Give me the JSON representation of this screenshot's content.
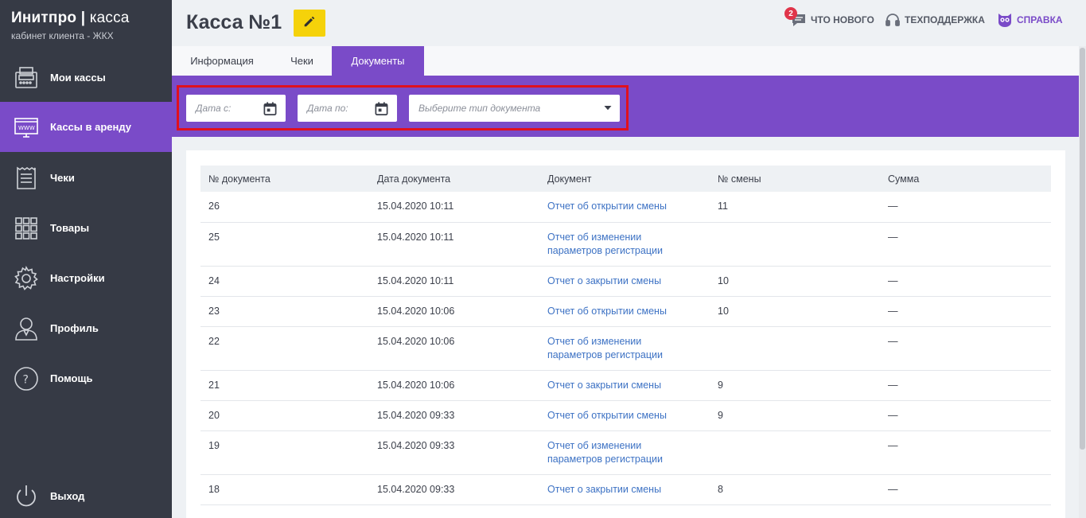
{
  "brand": {
    "title_bold": "Инитпро",
    "title_sep": " | ",
    "title_thin": "касса",
    "subtitle": "кабинет клиента - ЖКХ"
  },
  "sidebar": {
    "items": [
      {
        "label": "Мои кассы",
        "icon": "cash-register-icon",
        "active": false
      },
      {
        "label": "Кассы в аренду",
        "icon": "monitor-www-icon",
        "active": true
      },
      {
        "label": "Чеки",
        "icon": "receipt-icon",
        "active": false
      },
      {
        "label": "Товары",
        "icon": "grid-icon",
        "active": false
      },
      {
        "label": "Настройки",
        "icon": "gear-icon",
        "active": false
      },
      {
        "label": "Профиль",
        "icon": "user-icon",
        "active": false
      },
      {
        "label": "Помощь",
        "icon": "question-icon",
        "active": false
      }
    ],
    "logout": {
      "label": "Выход",
      "icon": "power-icon"
    }
  },
  "header": {
    "title": "Касса №1",
    "whats_new": {
      "label": "ЧТО НОВОГО",
      "badge": "2"
    },
    "support": {
      "label": "ТЕХПОДДЕРЖКА"
    },
    "help": {
      "label": "СПРАВКА"
    }
  },
  "tabs": [
    {
      "label": "Информация",
      "active": false
    },
    {
      "label": "Чеки",
      "active": false
    },
    {
      "label": "Документы",
      "active": true
    }
  ],
  "filters": {
    "date_from_placeholder": "Дата с:",
    "date_to_placeholder": "Дата по:",
    "doc_type_placeholder": "Выберите тип документа"
  },
  "table": {
    "columns": [
      "№ документа",
      "Дата документа",
      "Документ",
      "№ смены",
      "Сумма"
    ],
    "rows": [
      {
        "num": "26",
        "date": "15.04.2020 10:11",
        "doc1": "Отчет об открытии смены",
        "doc2": "",
        "shift": "11",
        "sum": "—"
      },
      {
        "num": "25",
        "date": "15.04.2020 10:11",
        "doc1": "Отчет об изменении",
        "doc2": "параметров регистрации",
        "shift": "",
        "sum": "—"
      },
      {
        "num": "24",
        "date": "15.04.2020 10:11",
        "doc1": "Отчет о закрытии смены",
        "doc2": "",
        "shift": "10",
        "sum": "—"
      },
      {
        "num": "23",
        "date": "15.04.2020 10:06",
        "doc1": "Отчет об открытии смены",
        "doc2": "",
        "shift": "10",
        "sum": "—"
      },
      {
        "num": "22",
        "date": "15.04.2020 10:06",
        "doc1": "Отчет об изменении",
        "doc2": "параметров регистрации",
        "shift": "",
        "sum": "—"
      },
      {
        "num": "21",
        "date": "15.04.2020 10:06",
        "doc1": "Отчет о закрытии смены",
        "doc2": "",
        "shift": "9",
        "sum": "—"
      },
      {
        "num": "20",
        "date": "15.04.2020 09:33",
        "doc1": "Отчет об открытии смены",
        "doc2": "",
        "shift": "9",
        "sum": "—"
      },
      {
        "num": "19",
        "date": "15.04.2020 09:33",
        "doc1": "Отчет об изменении",
        "doc2": "параметров регистрации",
        "shift": "",
        "sum": "—"
      },
      {
        "num": "18",
        "date": "15.04.2020 09:33",
        "doc1": "Отчет о закрытии смены",
        "doc2": "",
        "shift": "8",
        "sum": "—"
      }
    ]
  },
  "colors": {
    "accent": "#7a4bc8",
    "sidebar": "#363a45",
    "edit": "#f5d20a",
    "link": "#3d72c4",
    "highlight": "#e0101e"
  }
}
